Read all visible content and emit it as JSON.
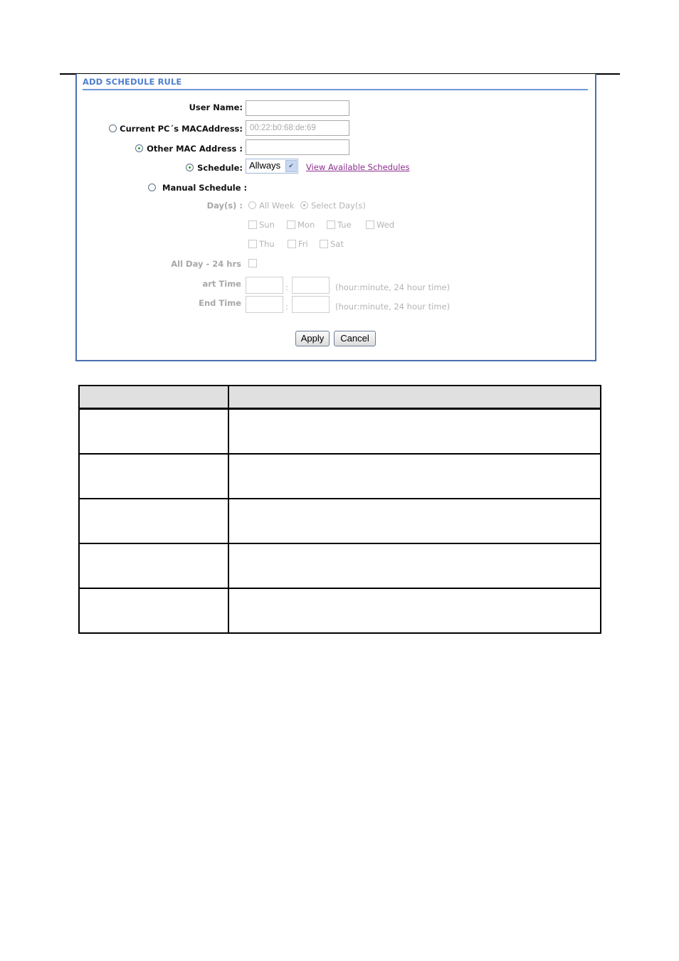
{
  "panel": {
    "title": "ADD SCHEDULE RULE",
    "accent_color": "#4a6fb0",
    "user_name": {
      "label": "User Name:",
      "value": ""
    },
    "current_pc_mac": {
      "label": "Current PC´s MACAddress:",
      "value": "00:22:b0:68:de:69",
      "selected": false
    },
    "other_mac": {
      "label": "Other MAC Address :",
      "value": "",
      "selected": true
    },
    "schedule": {
      "label": "Schedule:",
      "selected_option": "Allways",
      "selected": true,
      "link_label": "View Available Schedules"
    },
    "manual_schedule": {
      "label": "Manual Schedule :",
      "selected": false,
      "days_label": "Day(s) :",
      "all_week_label": "All Week",
      "select_days_label": "Select Day(s)",
      "days": [
        "Sun",
        "Mon",
        "Tue",
        "Wed",
        "Thu",
        "Fri",
        "Sat"
      ],
      "all_day_label": "All Day - 24 hrs",
      "start_time_label": "art Time",
      "end_time_label": "End Time",
      "time_separator": ":",
      "time_hint": "(hour:minute, 24 hour time)"
    },
    "apply_label": "Apply",
    "cancel_label": "Cancel"
  },
  "table": {
    "headers": [
      "",
      ""
    ],
    "rows": [
      [
        "",
        ""
      ],
      [
        "",
        ""
      ],
      [
        "",
        ""
      ],
      [
        "",
        ""
      ],
      [
        "",
        ""
      ]
    ]
  }
}
